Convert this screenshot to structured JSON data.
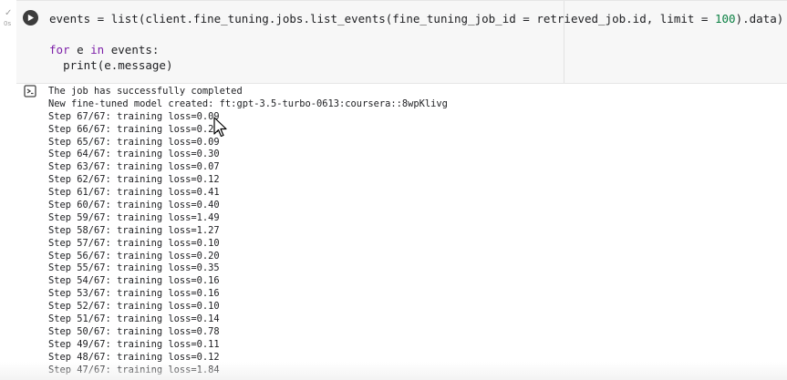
{
  "gutter": {
    "status_glyph": "✓",
    "exec_time": "0s"
  },
  "cell": {
    "code": {
      "line1": {
        "var": "events = list(client.fine_tuning.jobs.list_events(fine_tuning_job_id = retrieved_job.id, limit = ",
        "num": "100",
        "tail": ").data)"
      },
      "line2": {
        "kw_for": "for",
        "mid": " e ",
        "kw_in": "in",
        "tail": " events:"
      },
      "line3": {
        "indent": "  ",
        "text": "print(e.message)"
      }
    }
  },
  "output": {
    "lines": [
      "The job has successfully completed",
      "New fine-tuned model created: ft:gpt-3.5-turbo-0613:coursera::8wpKlivg",
      "Step 67/67: training loss=0.09",
      "Step 66/67: training loss=0.24",
      "Step 65/67: training loss=0.09",
      "Step 64/67: training loss=0.30",
      "Step 63/67: training loss=0.07",
      "Step 62/67: training loss=0.12",
      "Step 61/67: training loss=0.41",
      "Step 60/67: training loss=0.40",
      "Step 59/67: training loss=1.49",
      "Step 58/67: training loss=1.27",
      "Step 57/67: training loss=0.10",
      "Step 56/67: training loss=0.20",
      "Step 55/67: training loss=0.35",
      "Step 54/67: training loss=0.16",
      "Step 53/67: training loss=0.16",
      "Step 52/67: training loss=0.10",
      "Step 51/67: training loss=0.14",
      "Step 50/67: training loss=0.78",
      "Step 49/67: training loss=0.11",
      "Step 48/67: training loss=0.12",
      "Step 47/67: training loss=1.84"
    ]
  },
  "icons": {
    "run": "play-icon",
    "output": "output-icon",
    "cursor": "mouse-cursor-icon"
  }
}
